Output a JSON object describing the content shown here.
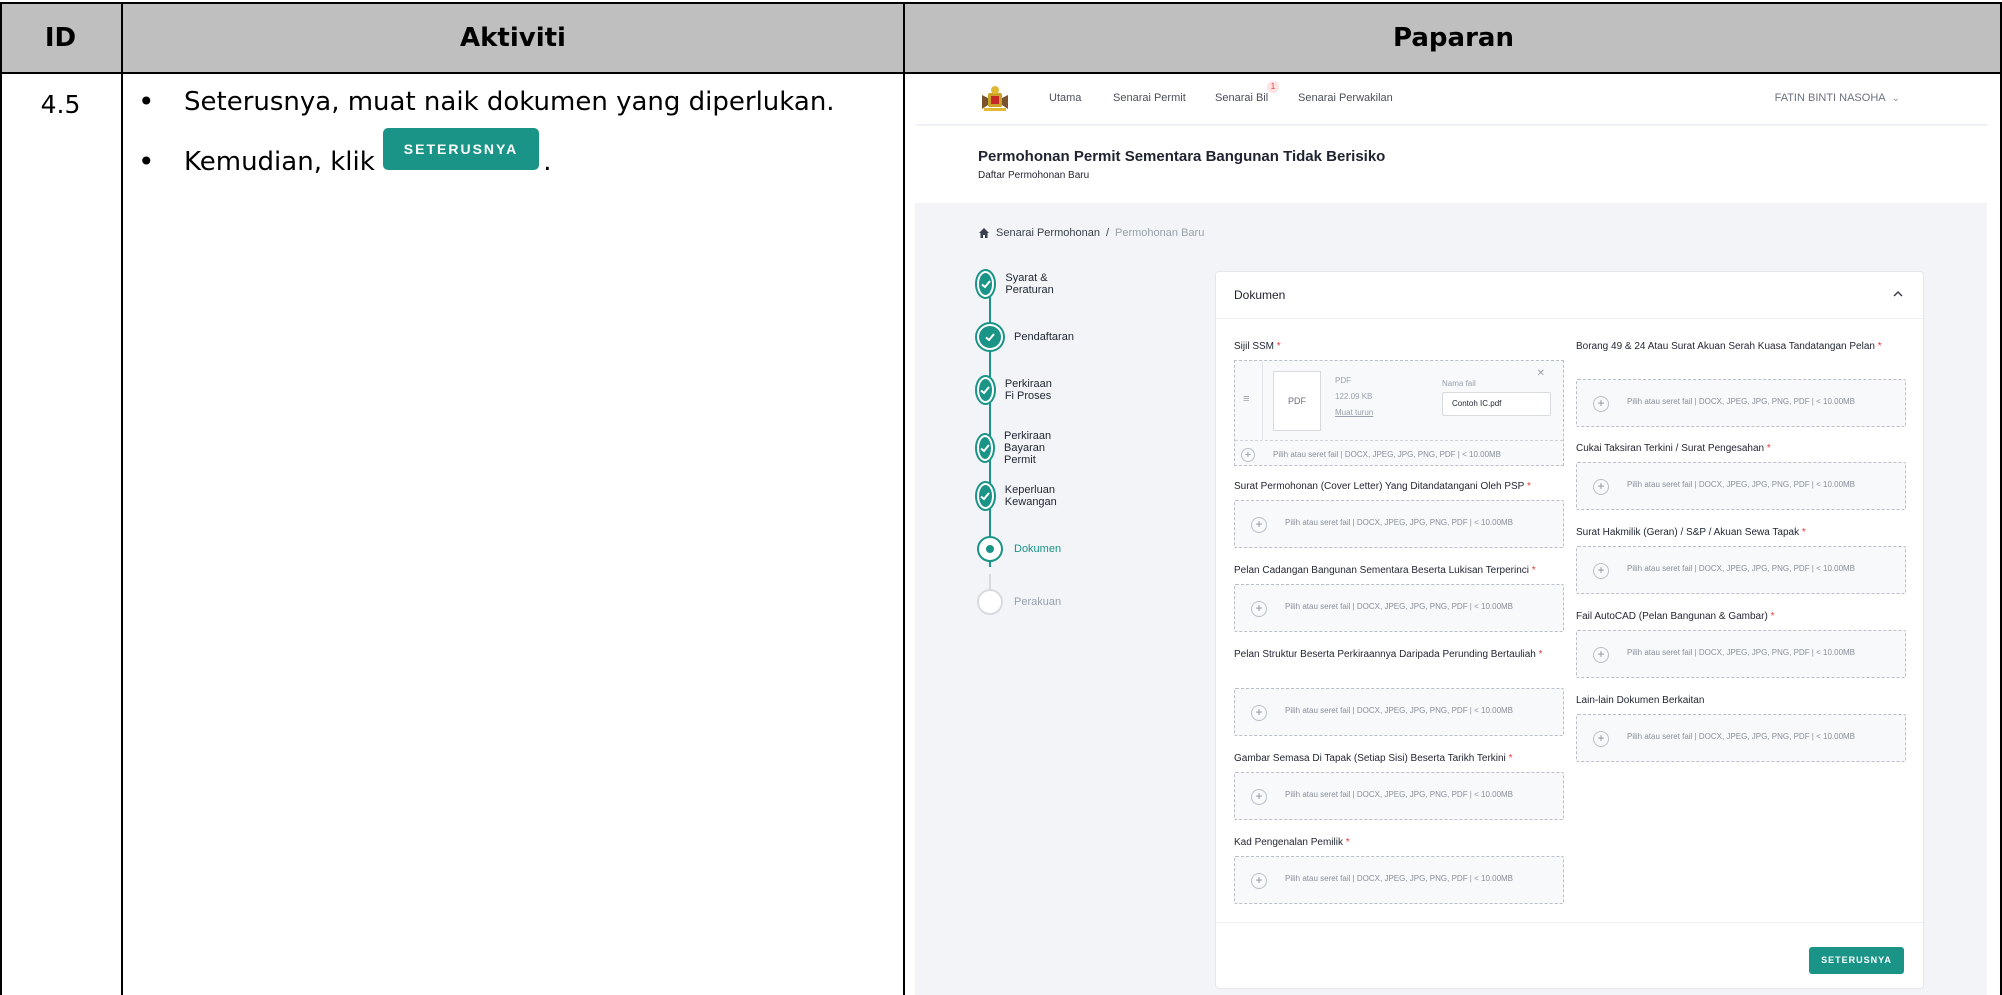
{
  "table": {
    "headers": {
      "id": "ID",
      "activity": "Aktiviti",
      "display": "Paparan"
    },
    "row": {
      "id": "4.5",
      "bullets": [
        "Seterusnya, muat naik dokumen yang diperlukan.",
        {
          "before": "Kemudian, klik",
          "button": "SETERUSNYA",
          "after": "."
        }
      ]
    }
  },
  "screen": {
    "nav": {
      "items": [
        "Utama",
        "Senarai Permit",
        "Senarai Bil",
        "Senarai Perwakilan"
      ],
      "notification_count": "1",
      "user": "FATIN BINTI NASOHA"
    },
    "page": {
      "title": "Permohonan Permit Sementara Bangunan Tidak Berisiko",
      "subtitle": "Daftar Permohonan Baru"
    },
    "breadcrumb": {
      "parent": "Senarai Permohonan",
      "separator": "/",
      "current": "Permohonan Baru"
    },
    "steps": [
      {
        "label": "Syarat & Peraturan",
        "state": "done"
      },
      {
        "label": "Pendaftaran",
        "state": "done"
      },
      {
        "label": "Perkiraan Fi Proses",
        "state": "done"
      },
      {
        "label": "Perkiraan Bayaran Permit",
        "state": "done"
      },
      {
        "label": "Keperluan Kewangan",
        "state": "done"
      },
      {
        "label": "Dokumen",
        "state": "active"
      },
      {
        "label": "Perakuan",
        "state": "todo"
      }
    ],
    "card": {
      "title": "Dokumen",
      "upload_hint": "Pilih atau seret fail | DOCX, JPEG, JPG, PNG, PDF | < 10.00MB",
      "ssm": {
        "label": "Sijil SSM",
        "thumb": "PDF",
        "type": "PDF",
        "size": "122.09 KB",
        "download": "Muat turun",
        "name_label": "Nama fail",
        "name_value": "Contoh IC.pdf"
      },
      "left_fields": [
        "Surat Permohonan (Cover Letter) Yang Ditandatangani Oleh PSP",
        "Pelan Cadangan Bangunan Sementara Beserta Lukisan Terperinci",
        "Pelan Struktur Beserta Perkiraannya Daripada Perunding Bertauliah",
        "Gambar Semasa Di Tapak (Setiap Sisi) Beserta Tarikh Terkini",
        "Kad Pengenalan Pemilik"
      ],
      "right_fields": [
        "Borang 49 & 24 Atau Surat Akuan Serah Kuasa Tandatangan Pelan",
        "Cukai Taksiran Terkini / Surat Pengesahan",
        "Surat Hakmilik (Geran) / S&P / Akuan Sewa Tapak",
        "Fail AutoCAD (Pelan Bangunan & Gambar)",
        "Lain-lain Dokumen Berkaitan"
      ],
      "next_button": "SETERUSNYA"
    }
  }
}
